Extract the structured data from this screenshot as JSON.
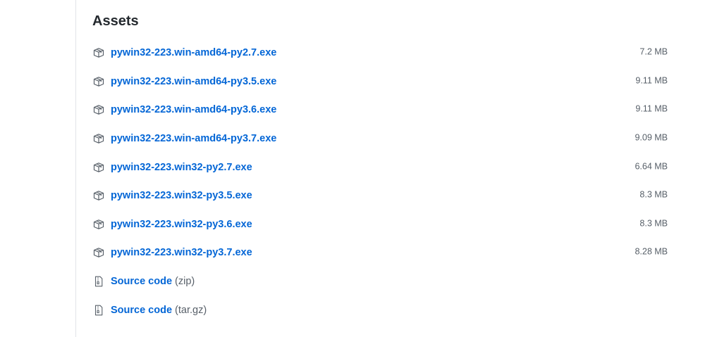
{
  "assets": {
    "heading": "Assets",
    "files": [
      {
        "name": "pywin32-223.win-amd64-py2.7.exe",
        "size": "7.2 MB",
        "icon": "package-icon"
      },
      {
        "name": "pywin32-223.win-amd64-py3.5.exe",
        "size": "9.11 MB",
        "icon": "package-icon"
      },
      {
        "name": "pywin32-223.win-amd64-py3.6.exe",
        "size": "9.11 MB",
        "icon": "package-icon"
      },
      {
        "name": "pywin32-223.win-amd64-py3.7.exe",
        "size": "9.09 MB",
        "icon": "package-icon"
      },
      {
        "name": "pywin32-223.win32-py2.7.exe",
        "size": "6.64 MB",
        "icon": "package-icon"
      },
      {
        "name": "pywin32-223.win32-py3.5.exe",
        "size": "8.3 MB",
        "icon": "package-icon"
      },
      {
        "name": "pywin32-223.win32-py3.6.exe",
        "size": "8.3 MB",
        "icon": "package-icon"
      },
      {
        "name": "pywin32-223.win32-py3.7.exe",
        "size": "8.28 MB",
        "icon": "package-icon"
      }
    ],
    "source_code": [
      {
        "label": "Source code",
        "format": "(zip)",
        "icon": "file-zip-icon"
      },
      {
        "label": "Source code",
        "format": "(tar.gz)",
        "icon": "file-zip-icon"
      }
    ]
  },
  "colors": {
    "link": "#0366d6",
    "heading": "#24292e",
    "muted": "#586069",
    "rule": "#e1e4e8"
  }
}
